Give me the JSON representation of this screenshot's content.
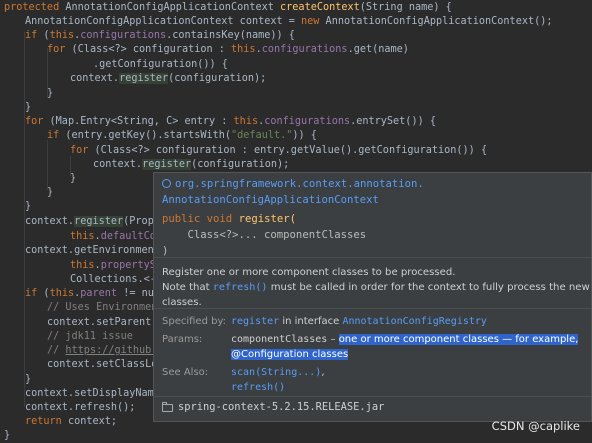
{
  "code": {
    "signature": {
      "kw": "protected",
      "type": "AnnotationConfigApplicationContext",
      "method": "createContext",
      "params": "(String name) {"
    },
    "l2": {
      "type": "AnnotationConfigApplicationContext",
      "var": " context = ",
      "new": "new",
      "ctor": " AnnotationConfigApplicationContext();"
    },
    "l3": {
      "kw": "if",
      "a": " (",
      "this": "this",
      "dot": ".",
      "field": "configurations",
      "rest": ".containsKey(name)) {"
    },
    "l4": {
      "kw": "for",
      "a": " (Class<?> configuration : ",
      "this": "this",
      "dot": ".",
      "field": "configurations",
      "rest": ".get(name)"
    },
    "l5": {
      "text": ".getConfiguration()) {"
    },
    "l6": {
      "a": "context.",
      "method": "register",
      "b": "(configuration);"
    },
    "l7": {
      "text": "}"
    },
    "l8": {
      "text": "}"
    },
    "l9": {
      "kw": "for",
      "a": " (Map.Entry<String, C> entry : ",
      "this": "this",
      "dot": ".",
      "field": "configurations",
      "rest": ".entrySet()) {"
    },
    "l10": {
      "kw": "if",
      "a": " (entry.getKey().startsWith(",
      "str": "\"default.\"",
      "b": ")) {"
    },
    "l11": {
      "kw": "for",
      "a": " (Class<?> configuration : entry.getValue().getConfiguration()) {"
    },
    "l12": {
      "a": "context.",
      "method": "register",
      "b": "(configuration);"
    },
    "l13": {
      "text": "}"
    },
    "l14": {
      "text": "}"
    },
    "l15": {
      "text": "}"
    },
    "l16": {
      "a": "context.",
      "method": "register",
      "b": "(Proper"
    },
    "l17": {
      "this": "this",
      "dot": ".",
      "field": "defaultCon"
    },
    "l18": {
      "a": "context.getEnvironment("
    },
    "l19": {
      "this": "this",
      "dot": ".",
      "field": "propertySo"
    },
    "l20": {
      "a": "Collections.<->"
    },
    "l21": {
      "kw": "if",
      "a": " (",
      "this": "this",
      "dot": ".",
      "field": "parent",
      "rest": " != null"
    },
    "l22": {
      "cmt": "// Uses Environment"
    },
    "l23": {
      "a": "context.setParent(t"
    },
    "l24": {
      "cmt": "// jdk11 issue"
    },
    "l25": {
      "cmt": "// ",
      "link": "https://github.c"
    },
    "l26": {
      "a": "context.setClassLoa"
    },
    "l27": {
      "text": "}"
    },
    "l28": {
      "a": "context.setDisplayName("
    },
    "l29": {
      "a": "context.refresh();"
    },
    "l30": {
      "kw": "return",
      "a": " context;"
    },
    "l31": {
      "text": "}"
    }
  },
  "popup": {
    "package": "org.springframework.context.annotation.",
    "class": "AnnotationConfigApplicationContext",
    "signature_kw": "public void",
    "signature_method": "register(",
    "signature_param": "    Class<?>... componentClasses",
    "signature_close": ")",
    "description_1": "Register one or more component classes to be processed.",
    "description_2a": "Note that ",
    "description_2_code": "refresh()",
    "description_2b": " must be called in order for the context to fully process the new classes.",
    "specified_by_label": "Specified by:",
    "specified_by_method": "register",
    "specified_by_mid": " in interface ",
    "specified_by_interface": "AnnotationConfigRegistry",
    "params_label": "Params:",
    "params_name": "componentClasses",
    "params_dash": " – ",
    "params_desc_1": "one or more component classes — for example,",
    "params_desc_2": "@Configuration classes",
    "see_also_label": "See Also:",
    "see_also_1": "scan(String...)",
    "see_also_sep": ",",
    "see_also_2": "refresh()",
    "jar": "spring-context-5.2.15.RELEASE.jar"
  },
  "watermark": "CSDN @caplike",
  "colors": {
    "background": "#2b2b2b",
    "keyword": "#cc7832",
    "field": "#9876aa",
    "method": "#ffc66d",
    "string": "#6a8759",
    "link": "#589df6",
    "selection": "#2f65ca",
    "popup": "#3c3f41"
  }
}
